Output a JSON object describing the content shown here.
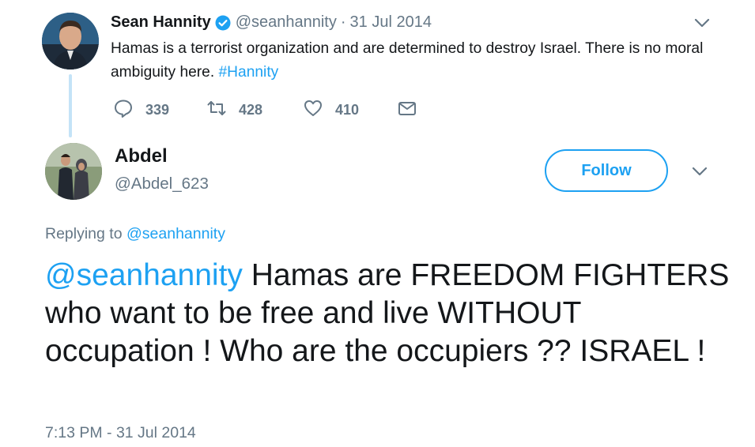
{
  "parent_tweet": {
    "display_name": "Sean Hannity",
    "handle": "@seanhannity",
    "separator": "·",
    "date": "31 Jul 2014",
    "text": "Hamas is a terrorist organization and are determined to destroy Israel. There is no moral ambiguity here. ",
    "hashtag": "#Hannity",
    "replies": "339",
    "retweets": "428",
    "likes": "410",
    "verified": true
  },
  "reply_author": {
    "display_name": "Abdel",
    "handle": "@Abdel_623",
    "follow_label": "Follow"
  },
  "replying_to": {
    "prefix": "Replying to ",
    "mention": "@seanhannity"
  },
  "reply_tweet": {
    "mention": "@seanhannity",
    "text": " Hamas are FREEDOM FIGHTERS who want to be free and live WITHOUT occupation ! Who are the occupiers ?? ISRAEL !",
    "timestamp": "7:13 PM - 31 Jul 2014"
  },
  "colors": {
    "accent": "#1da1f2",
    "secondary_text": "#657786",
    "primary_text": "#14171a",
    "thread_line": "#c4e3f7"
  },
  "icons": [
    "reply-icon",
    "retweet-icon",
    "like-icon",
    "direct-message-icon",
    "chevron-down-icon",
    "verified-badge-icon"
  ]
}
